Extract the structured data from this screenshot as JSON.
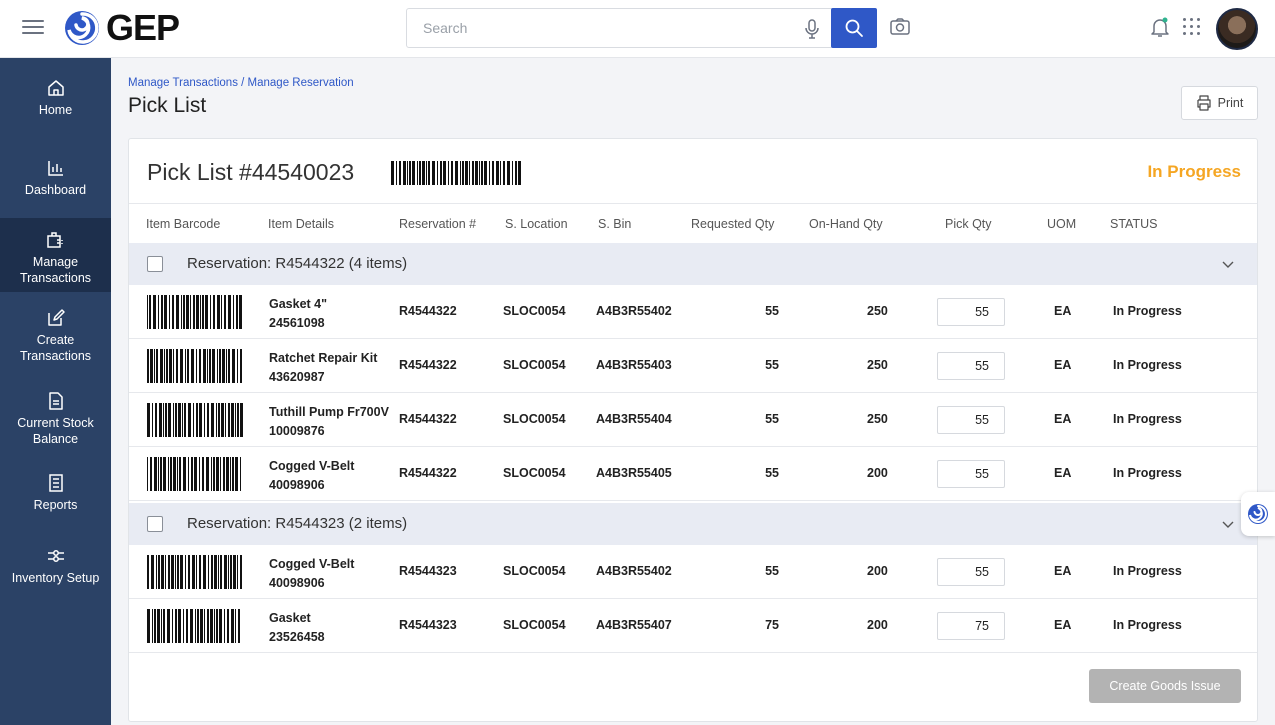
{
  "app": {
    "logo_text": "GEP"
  },
  "search": {
    "placeholder": "Search",
    "value": ""
  },
  "sidebar": {
    "items": [
      {
        "label": "Home",
        "icon": "home-icon"
      },
      {
        "label": "Dashboard",
        "icon": "dashboard-icon"
      },
      {
        "label": "Manage Transactions",
        "icon": "manage-transactions-icon",
        "active": true
      },
      {
        "label": "Create Transactions",
        "icon": "edit-icon"
      },
      {
        "label": "Current Stock Balance",
        "icon": "document-icon"
      },
      {
        "label": "Reports",
        "icon": "reports-icon"
      },
      {
        "label": "Inventory Setup",
        "icon": "settings-slider-icon"
      }
    ]
  },
  "header": {
    "breadcrumb": "Manage Transactions / Manage Reservation",
    "title": "Pick List",
    "print_label": "Print"
  },
  "card": {
    "title": "Pick List #44540023",
    "status": "In Progress",
    "status_color": "#f5a623",
    "columns": [
      "Item Barcode",
      "Item Details",
      "Reservation #",
      "S. Location",
      "S. Bin",
      "Requested Qty",
      "On-Hand Qty",
      "Pick Qty",
      "UOM",
      "STATUS"
    ]
  },
  "groups": [
    {
      "title": "Reservation: R4544322 (4 items)",
      "rows": [
        {
          "name": "Gasket 4\"",
          "code": "24561098",
          "reservation": "R4544322",
          "location": "SLOC0054",
          "bin": "A4B3R55402",
          "requested": "55",
          "onhand": "250",
          "pick": "55",
          "uom": "EA",
          "status": "In Progress"
        },
        {
          "name": "Ratchet Repair Kit",
          "code": "43620987",
          "reservation": "R4544322",
          "location": "SLOC0054",
          "bin": "A4B3R55403",
          "requested": "55",
          "onhand": "250",
          "pick": "55",
          "uom": "EA",
          "status": "In Progress"
        },
        {
          "name": "Tuthill Pump Fr700V",
          "code": "10009876",
          "reservation": "R4544322",
          "location": "SLOC0054",
          "bin": "A4B3R55404",
          "requested": "55",
          "onhand": "250",
          "pick": "55",
          "uom": "EA",
          "status": "In Progress"
        },
        {
          "name": "Cogged V-Belt",
          "code": "40098906",
          "reservation": "R4544322",
          "location": "SLOC0054",
          "bin": "A4B3R55405",
          "requested": "55",
          "onhand": "200",
          "pick": "55",
          "uom": "EA",
          "status": "In Progress"
        }
      ]
    },
    {
      "title": "Reservation: R4544323 (2 items)",
      "rows": [
        {
          "name": "Cogged V-Belt",
          "code": "40098906",
          "reservation": "R4544323",
          "location": "SLOC0054",
          "bin": "A4B3R55402",
          "requested": "55",
          "onhand": "200",
          "pick": "55",
          "uom": "EA",
          "status": "In Progress"
        },
        {
          "name": "Gasket",
          "code": "23526458",
          "reservation": "R4544323",
          "location": "SLOC0054",
          "bin": "A4B3R55407",
          "requested": "75",
          "onhand": "200",
          "pick": "75",
          "uom": "EA",
          "status": "In Progress"
        }
      ]
    }
  ],
  "footer": {
    "create_label": "Create Goods Issue"
  },
  "colors": {
    "sidebar": "#2b4266",
    "accent": "#2f58c7",
    "status": "#f5a623"
  }
}
